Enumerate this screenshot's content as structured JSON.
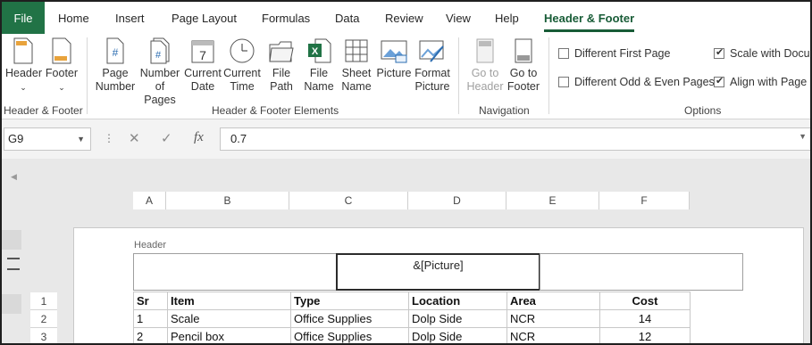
{
  "ribbon_tabs": [
    "File",
    "Home",
    "Insert",
    "Page Layout",
    "Formulas",
    "Data",
    "Review",
    "View",
    "Help",
    "Header & Footer"
  ],
  "active_tab": "Header & Footer",
  "groups": {
    "header_footer": {
      "label": "Header & Footer",
      "buttons": [
        {
          "label": "Header",
          "icon": "header-page-icon"
        },
        {
          "label": "Footer",
          "icon": "footer-page-icon"
        }
      ]
    },
    "elements": {
      "label": "Header & Footer Elements",
      "buttons": [
        {
          "line1": "Page",
          "line2": "Number",
          "icon": "page-number-icon"
        },
        {
          "line1": "Number",
          "line2": "of Pages",
          "icon": "number-of-pages-icon"
        },
        {
          "line1": "Current",
          "line2": "Date",
          "icon": "calendar-icon"
        },
        {
          "line1": "Current",
          "line2": "Time",
          "icon": "clock-icon"
        },
        {
          "line1": "File",
          "line2": "Path",
          "icon": "folder-icon"
        },
        {
          "line1": "File",
          "line2": "Name",
          "icon": "excel-file-icon"
        },
        {
          "line1": "Sheet",
          "line2": "Name",
          "icon": "sheet-grid-icon"
        },
        {
          "line1": "Picture",
          "line2": "",
          "icon": "picture-icon"
        },
        {
          "line1": "Format",
          "line2": "Picture",
          "icon": "format-picture-icon"
        }
      ]
    },
    "navigation": {
      "label": "Navigation",
      "buttons": [
        {
          "line1": "Go to",
          "line2": "Header",
          "icon": "go-to-header-icon",
          "disabled": true
        },
        {
          "line1": "Go to",
          "line2": "Footer",
          "icon": "go-to-footer-icon",
          "disabled": false
        }
      ]
    },
    "options": {
      "label": "Options",
      "checkboxes": [
        {
          "label": "Different First Page",
          "checked": false
        },
        {
          "label": "Different Odd & Even Pages",
          "checked": false
        },
        {
          "label": "Scale with Docu",
          "checked": true
        },
        {
          "label": "Align with Page",
          "checked": true
        }
      ]
    }
  },
  "formula_bar": {
    "name_box": "G9",
    "formula": "0.7"
  },
  "sheet": {
    "column_headers": [
      "A",
      "B",
      "C",
      "D",
      "E",
      "F"
    ],
    "row_headers": [
      "1",
      "2",
      "3"
    ],
    "header_label": "Header",
    "header_center": "&[Picture]",
    "table_head": [
      "Sr",
      "Item",
      "Type",
      "Location",
      "Area",
      "Cost"
    ],
    "rows": [
      [
        "1",
        "Scale",
        "Office Supplies",
        "Dolp Side",
        "NCR",
        "14"
      ],
      [
        "2",
        "Pencil box",
        "Office Supplies",
        "Dolp Side",
        "NCR",
        "12"
      ]
    ]
  },
  "colors": {
    "file_tab": "#217346",
    "active_tab": "#185c37",
    "formula_bar_bg": "#f3f3f3",
    "sheet_bg": "#e8e8e8"
  }
}
